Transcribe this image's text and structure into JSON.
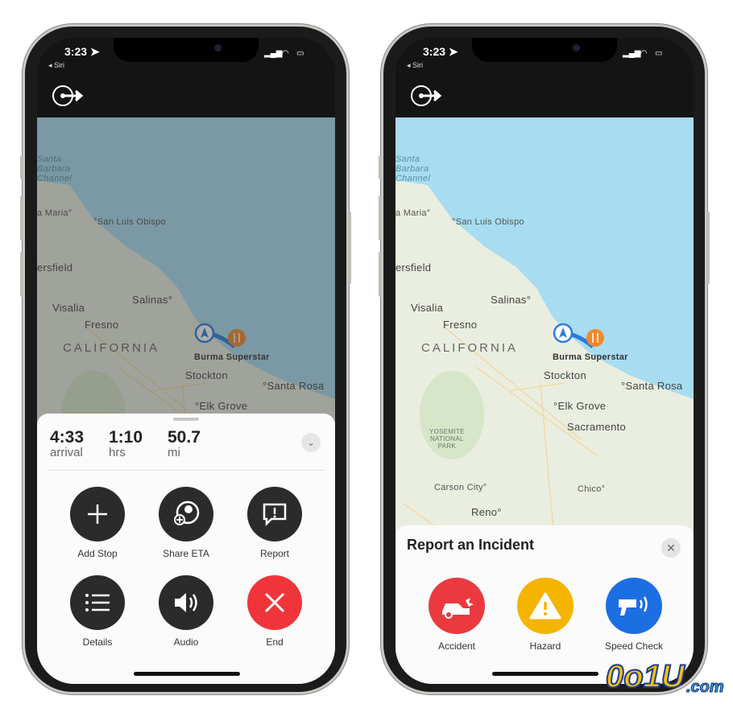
{
  "status_bar": {
    "time": "3:23 ➤",
    "back_label": "◂ Siri"
  },
  "map": {
    "labels": [
      {
        "text": "Santa\nBarbara\nChannel",
        "type": "water"
      },
      {
        "text": "a Maria°",
        "type": "city"
      },
      {
        "text": "°San Luis Obispo",
        "type": "small"
      },
      {
        "text": "ersfield",
        "type": "big"
      },
      {
        "text": "Salinas°",
        "type": "big"
      },
      {
        "text": "Visalia",
        "type": "big"
      },
      {
        "text": "Fresno",
        "type": "big"
      },
      {
        "text": "CALIFORNIA",
        "type": "state"
      },
      {
        "text": "Burma Superstar",
        "type": "poi"
      },
      {
        "text": "Stockton",
        "type": "big"
      },
      {
        "text": "°Santa Rosa",
        "type": "big"
      },
      {
        "text": "°Elk Grove",
        "type": "big"
      },
      {
        "text": "Sacramento",
        "type": "big"
      },
      {
        "text": "YOSEMITE\nNATIONAL\nPARK",
        "type": "park"
      },
      {
        "text": "Carson City°",
        "type": "city"
      },
      {
        "text": "Chico°",
        "type": "city"
      },
      {
        "text": "Reno°",
        "type": "big"
      }
    ],
    "colors": {
      "water": "#a8dcf0",
      "land": "#e9eee0",
      "route": "#2d7be0",
      "pin": "#f08a2a"
    }
  },
  "trip": {
    "stats": [
      {
        "value": "4:33",
        "unit": "arrival"
      },
      {
        "value": "1:10",
        "unit": "hrs"
      },
      {
        "value": "50.7",
        "unit": "mi"
      }
    ],
    "actions": [
      {
        "label": "Add Stop",
        "icon": "plus-icon"
      },
      {
        "label": "Share ETA",
        "icon": "share-eta-icon"
      },
      {
        "label": "Report",
        "icon": "report-icon"
      },
      {
        "label": "Details",
        "icon": "list-icon"
      },
      {
        "label": "Audio",
        "icon": "speaker-icon"
      },
      {
        "label": "End",
        "icon": "close-icon",
        "color": "#f0353a"
      }
    ]
  },
  "report": {
    "title": "Report an Incident",
    "options": [
      {
        "label": "Accident",
        "icon": "accident-icon",
        "color": "#ea3a3f"
      },
      {
        "label": "Hazard",
        "icon": "hazard-icon",
        "color": "#f4b400"
      },
      {
        "label": "Speed Check",
        "icon": "speed-camera-icon",
        "color": "#1c6fe3"
      }
    ]
  },
  "watermark": {
    "text": "0o1U.com"
  }
}
